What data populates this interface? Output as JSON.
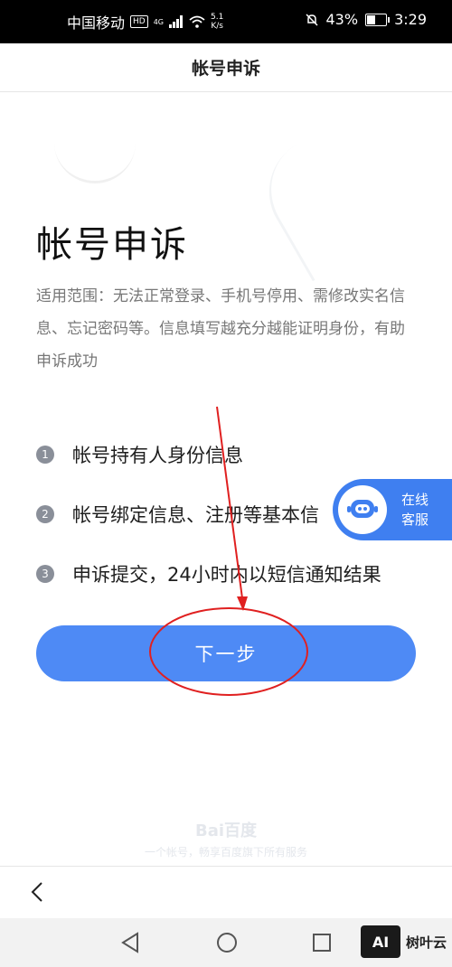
{
  "status_bar": {
    "carrier": "中国移动",
    "hd": "HD",
    "network": "4G",
    "speed_value": "5.1",
    "speed_unit": "K/s",
    "battery": "43%",
    "time": "3:29"
  },
  "header": {
    "title": "帐号申诉"
  },
  "main": {
    "title": "帐号申诉",
    "description": "适用范围：无法正常登录、手机号停用、需修改实名信息、忘记密码等。信息填写越充分越能证明身份，有助申诉成功",
    "steps": [
      {
        "num": "1",
        "text": "帐号持有人身份信息"
      },
      {
        "num": "2",
        "text": "帐号绑定信息、注册等基本信"
      },
      {
        "num": "3",
        "text": "申诉提交，24小时内以短信通知结果"
      }
    ],
    "next_button": "下一步"
  },
  "customer_service": {
    "line1": "在线",
    "line2": "客服"
  },
  "footer": {
    "logo": "Bai百度",
    "slogan": "一个帐号，畅享百度旗下所有服务"
  },
  "watermark": {
    "badge": "AI",
    "text": "树叶云"
  },
  "colors": {
    "accent": "#4e8af5",
    "float": "#3f7ff0",
    "annotation": "#e02020"
  }
}
